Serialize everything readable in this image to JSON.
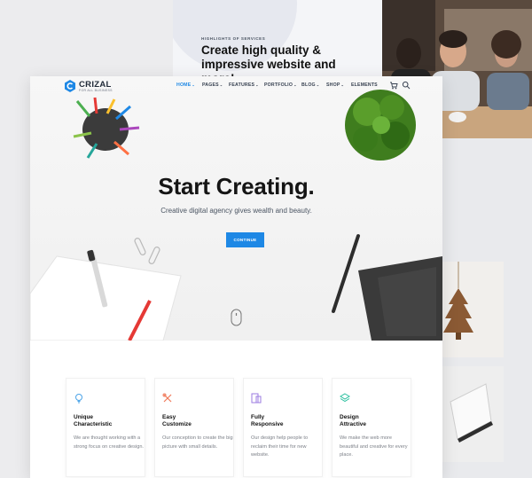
{
  "background": {
    "eyebrow": "HIGHLIGHTS OF SERVICES",
    "heading": "Create high quality & impressive website and more!"
  },
  "nav": {
    "brand": "CRIZAL",
    "tagline": "FOR ALL BUSINESS",
    "items": [
      "HOME",
      "PAGES",
      "FEATURES",
      "PORTFOLIO",
      "BLOG",
      "SHOP",
      "ELEMENTS"
    ],
    "active_index": 0,
    "icons": [
      "cart-icon",
      "search-icon"
    ]
  },
  "hero": {
    "title": "Start Creating.",
    "subtitle": "Creative digital agency gives wealth and beauty.",
    "cta_label": "CONTINUE"
  },
  "features": [
    {
      "icon": "lightbulb-icon",
      "color": "#4aa3e8",
      "title": "Unique\nCharacteristic",
      "desc": "We are thought working with a strong focus on creative design."
    },
    {
      "icon": "tools-icon",
      "color": "#f07a5a",
      "title": "Easy\nCustomize",
      "desc": "Our conception to create the big picture with small details."
    },
    {
      "icon": "devices-icon",
      "color": "#9b7be0",
      "title": "Fully\nResponsive",
      "desc": "Our design help people to reclaim their time for new website."
    },
    {
      "icon": "layers-icon",
      "color": "#2bbf9f",
      "title": "Design\nAttractive",
      "desc": "We make the web more beautiful and creative for every place."
    }
  ],
  "colors": {
    "accent": "#1e88e5",
    "heading": "#151515"
  }
}
